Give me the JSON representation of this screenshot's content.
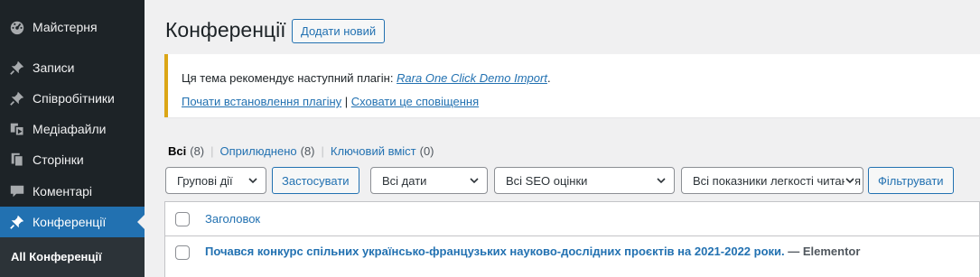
{
  "sidebar": {
    "items": [
      {
        "label": "Майстерня",
        "icon": "dashboard-icon"
      },
      {
        "label": "Записи",
        "icon": "pin-icon"
      },
      {
        "label": "Співробітники",
        "icon": "pin-icon"
      },
      {
        "label": "Медіафайли",
        "icon": "media-icon"
      },
      {
        "label": "Сторінки",
        "icon": "pages-icon"
      },
      {
        "label": "Коментарі",
        "icon": "comment-icon"
      },
      {
        "label": "Конференції",
        "icon": "pin-icon",
        "active": true
      }
    ],
    "submenu": {
      "label": "All Конференції"
    }
  },
  "header": {
    "title": "Конференції",
    "add_new_label": "Додати новий"
  },
  "notice": {
    "text_prefix": "Ця тема рекомендує наступний плагін: ",
    "plugin_name": "Rara One Click Demo Import",
    "text_suffix": ".",
    "install_link": "Почати встановлення плагіну",
    "separator": " | ",
    "dismiss_link": "Сховати це сповіщення",
    "border_color": "#dba617"
  },
  "views": [
    {
      "label": "Всі",
      "count": "(8)",
      "current": true
    },
    {
      "label": "Оприлюднено",
      "count": "(8)"
    },
    {
      "label": "Ключовий вміст",
      "count": "(0)"
    }
  ],
  "filters": {
    "bulk_actions": "Групові дії",
    "apply_label": "Застосувати",
    "dates": "Всі дати",
    "seo": "Всі SEO оцінки",
    "readability": "Всі показники легкості читання",
    "filter_label": "Фільтрувати"
  },
  "table": {
    "column_title": "Заголовок",
    "rows": [
      {
        "title": "Почався конкурс спільних українсько-французьких науково-дослідних проєктів на 2021-2022 роки.",
        "suffix": " — Elementor"
      }
    ]
  },
  "colors": {
    "accent": "#2271b1",
    "sidebar_bg": "#1d2327"
  }
}
